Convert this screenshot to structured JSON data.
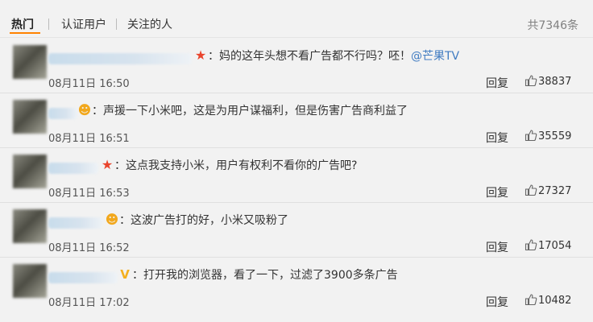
{
  "tabs": [
    {
      "label": "热门",
      "active": true
    },
    {
      "label": "认证用户",
      "active": false
    },
    {
      "label": "关注的人",
      "active": false
    }
  ],
  "total_count": "共7346条",
  "comments": [
    {
      "badge": "star-icon",
      "colon": "：",
      "text": "妈的这年头想不看广告都不行吗？呸！",
      "mention": "@芒果TV",
      "date": "08月11日 16:50",
      "reply": "回复",
      "likes": "38837"
    },
    {
      "badge": "smile-icon",
      "colon": "：",
      "text": "声援一下小米吧，这是为用户谋福利，但是伤害广告商利益了",
      "mention": "",
      "date": "08月11日 16:51",
      "reply": "回复",
      "likes": "35559"
    },
    {
      "badge": "star-icon",
      "colon": "：",
      "text": "这点我支持小米，用户有权利不看你的广告吧?",
      "mention": "",
      "date": "08月11日 16:53",
      "reply": "回复",
      "likes": "27327"
    },
    {
      "badge": "smile-icon",
      "colon": "：",
      "text": "这波广告打的好，小米又吸粉了",
      "mention": "",
      "date": "08月11日 16:52",
      "reply": "回复",
      "likes": "17054"
    },
    {
      "badge": "v-icon",
      "colon": "：",
      "text": "打开我的浏览器，看了一下，过滤了3900多条广告",
      "mention": "",
      "date": "08月11日 17:02",
      "reply": "回复",
      "likes": "10482"
    }
  ],
  "colors": {
    "mention": "#3f7bc1",
    "star": "#e9442c",
    "tab_accent": "#ff8200"
  }
}
